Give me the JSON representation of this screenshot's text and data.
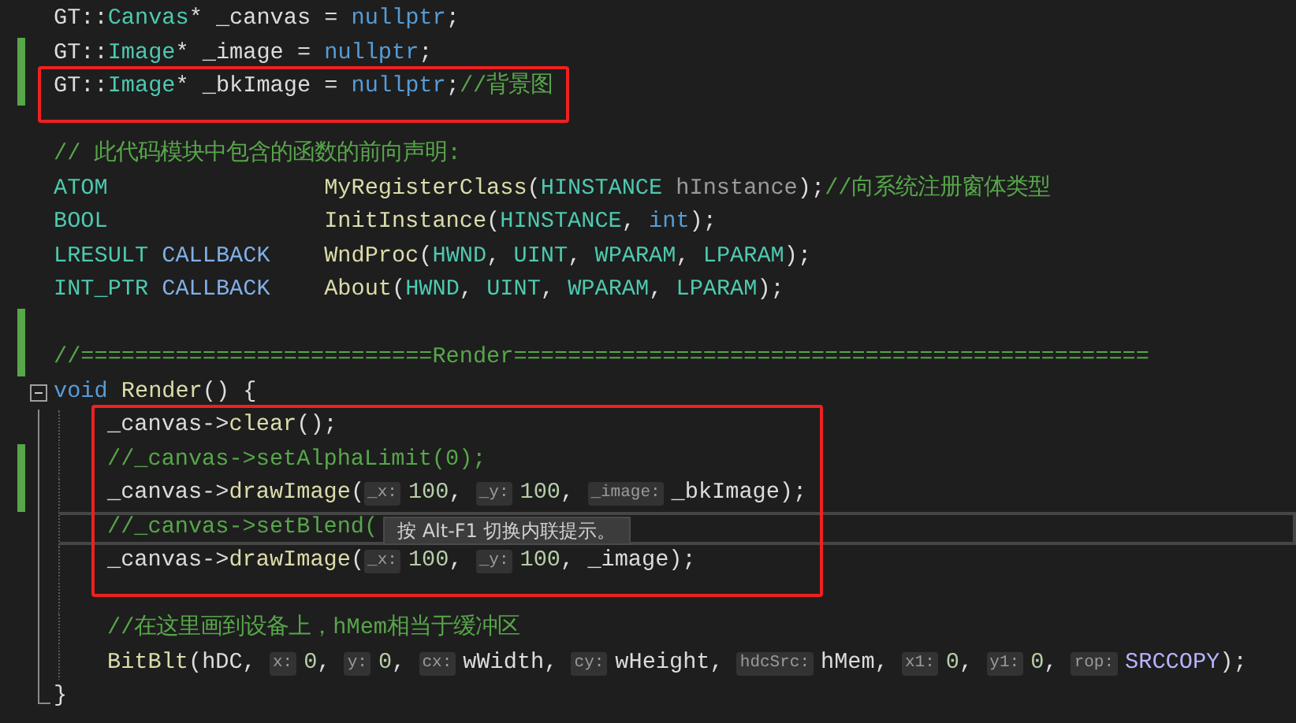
{
  "editor": {
    "lines": [
      {
        "changed": false,
        "tokens": [
          {
            "text": "GT::",
            "kind": "plain"
          },
          {
            "text": "Canvas",
            "kind": "type"
          },
          {
            "text": "* _canvas = ",
            "kind": "plain"
          },
          {
            "text": "nullptr",
            "kind": "keyword"
          },
          {
            "text": ";",
            "kind": "plain"
          }
        ]
      },
      {
        "changed": true,
        "tokens": [
          {
            "text": "GT::",
            "kind": "plain"
          },
          {
            "text": "Image",
            "kind": "type"
          },
          {
            "text": "* _image = ",
            "kind": "plain"
          },
          {
            "text": "nullptr",
            "kind": "keyword"
          },
          {
            "text": ";",
            "kind": "plain"
          }
        ]
      },
      {
        "changed": true,
        "boxed": true,
        "tokens": [
          {
            "text": "GT::",
            "kind": "plain"
          },
          {
            "text": "Image",
            "kind": "type"
          },
          {
            "text": "* _bkImage = ",
            "kind": "plain"
          },
          {
            "text": "nullptr",
            "kind": "keyword"
          },
          {
            "text": ";",
            "kind": "plain"
          },
          {
            "text": "//背景图",
            "kind": "comment"
          }
        ]
      },
      {
        "changed": false
      },
      {
        "changed": false,
        "tokens": [
          {
            "text": "// 此代码模块中包含的函数的前向声明:",
            "kind": "comment"
          }
        ]
      },
      {
        "changed": false,
        "tokens": [
          {
            "text": "ATOM",
            "kind": "type"
          }
        ],
        "aligned": [
          {
            "text": "MyRegisterClass",
            "kind": "func"
          },
          {
            "text": "(",
            "kind": "plain"
          },
          {
            "text": "HINSTANCE",
            "kind": "type"
          },
          {
            "text": " hInstance",
            "kind": "param"
          },
          {
            "text": ");",
            "kind": "plain"
          },
          {
            "text": "//向系统注册窗体类型",
            "kind": "comment"
          }
        ]
      },
      {
        "changed": false,
        "tokens": [
          {
            "text": "BOOL",
            "kind": "type"
          }
        ],
        "aligned": [
          {
            "text": "InitInstance",
            "kind": "func"
          },
          {
            "text": "(",
            "kind": "plain"
          },
          {
            "text": "HINSTANCE",
            "kind": "type"
          },
          {
            "text": ", ",
            "kind": "plain"
          },
          {
            "text": "int",
            "kind": "keyword"
          },
          {
            "text": ");",
            "kind": "plain"
          }
        ]
      },
      {
        "changed": false,
        "tokens": [
          {
            "text": "LRESULT",
            "kind": "type"
          },
          {
            "text": " CALLBACK",
            "kind": "macro"
          }
        ],
        "aligned": [
          {
            "text": "WndProc",
            "kind": "func"
          },
          {
            "text": "(",
            "kind": "plain"
          },
          {
            "text": "HWND",
            "kind": "type"
          },
          {
            "text": ", ",
            "kind": "plain"
          },
          {
            "text": "UINT",
            "kind": "type"
          },
          {
            "text": ", ",
            "kind": "plain"
          },
          {
            "text": "WPARAM",
            "kind": "type"
          },
          {
            "text": ", ",
            "kind": "plain"
          },
          {
            "text": "LPARAM",
            "kind": "type"
          },
          {
            "text": ");",
            "kind": "plain"
          }
        ]
      },
      {
        "changed": false,
        "tokens": [
          {
            "text": "INT_PTR",
            "kind": "type"
          },
          {
            "text": " CALLBACK",
            "kind": "macro"
          }
        ],
        "aligned": [
          {
            "text": "About",
            "kind": "func"
          },
          {
            "text": "(",
            "kind": "plain"
          },
          {
            "text": "HWND",
            "kind": "type"
          },
          {
            "text": ", ",
            "kind": "plain"
          },
          {
            "text": "UINT",
            "kind": "type"
          },
          {
            "text": ", ",
            "kind": "plain"
          },
          {
            "text": "WPARAM",
            "kind": "type"
          },
          {
            "text": ", ",
            "kind": "plain"
          },
          {
            "text": "LPARAM",
            "kind": "type"
          },
          {
            "text": ");",
            "kind": "plain"
          }
        ]
      },
      {
        "changed": true
      },
      {
        "changed": true,
        "tokens": [
          {
            "text": "//==========================Render===============================================",
            "kind": "comment"
          }
        ]
      },
      {
        "changed": false,
        "expanded": true,
        "tokens": [
          {
            "text": "void",
            "kind": "keyword"
          },
          {
            "text": " Render",
            "kind": "func"
          },
          {
            "text": "() {",
            "kind": "plain"
          }
        ],
        "children": [
          {
            "changed": false,
            "boxed": true,
            "tokens": [
              {
                "text": "_canvas->",
                "kind": "plain"
              },
              {
                "text": "clear",
                "kind": "func"
              },
              {
                "text": "();",
                "kind": "plain"
              }
            ]
          },
          {
            "changed": true,
            "boxed": true,
            "tokens": [
              {
                "text": "//_canvas->setAlphaLimit(0);",
                "kind": "comment"
              }
            ]
          },
          {
            "changed": true,
            "boxed": true,
            "tokens": [
              {
                "text": "_canvas->",
                "kind": "plain"
              },
              {
                "text": "drawImage",
                "kind": "func"
              },
              {
                "text": "(",
                "kind": "plain"
              },
              {
                "text": "_x:",
                "kind": "hint"
              },
              {
                "text": "100",
                "kind": "number"
              },
              {
                "text": ", ",
                "kind": "plain"
              },
              {
                "text": "_y:",
                "kind": "hint"
              },
              {
                "text": "100",
                "kind": "number"
              },
              {
                "text": ", ",
                "kind": "plain"
              },
              {
                "text": "_image:",
                "kind": "hint"
              },
              {
                "text": "_bkImage);",
                "kind": "plain"
              }
            ]
          },
          {
            "changed": false,
            "boxed": true,
            "current": true,
            "tooltip": "按 Alt-F1 切换内联提示。",
            "tokens": [
              {
                "text": "//_canvas->setBlend(",
                "kind": "comment"
              }
            ]
          },
          {
            "changed": false,
            "boxed": true,
            "tokens": [
              {
                "text": "_canvas->",
                "kind": "plain"
              },
              {
                "text": "drawImage",
                "kind": "func"
              },
              {
                "text": "(",
                "kind": "plain"
              },
              {
                "text": "_x:",
                "kind": "hint"
              },
              {
                "text": "100",
                "kind": "number"
              },
              {
                "text": ", ",
                "kind": "plain"
              },
              {
                "text": "_y:",
                "kind": "hint"
              },
              {
                "text": "100",
                "kind": "number"
              },
              {
                "text": ", ",
                "kind": "plain"
              },
              {
                "text": "_image);",
                "kind": "plain"
              }
            ]
          },
          {
            "changed": false
          },
          {
            "changed": false,
            "tokens": [
              {
                "text": "//在这里画到设备上，hMem相当于缓冲区",
                "kind": "comment"
              }
            ]
          },
          {
            "changed": false,
            "tokens": [
              {
                "text": "BitBlt",
                "kind": "func"
              },
              {
                "text": "(hDC, ",
                "kind": "plain"
              },
              {
                "text": "x:",
                "kind": "hint"
              },
              {
                "text": "0",
                "kind": "number"
              },
              {
                "text": ", ",
                "kind": "plain"
              },
              {
                "text": "y:",
                "kind": "hint"
              },
              {
                "text": "0",
                "kind": "number"
              },
              {
                "text": ", ",
                "kind": "plain"
              },
              {
                "text": "cx:",
                "kind": "hint"
              },
              {
                "text": "wWidth, ",
                "kind": "plain"
              },
              {
                "text": "cy:",
                "kind": "hint"
              },
              {
                "text": "wHeight, ",
                "kind": "plain"
              },
              {
                "text": "hdcSrc:",
                "kind": "hint"
              },
              {
                "text": "hMem, ",
                "kind": "plain"
              },
              {
                "text": "x1:",
                "kind": "hint"
              },
              {
                "text": "0",
                "kind": "number"
              },
              {
                "text": ", ",
                "kind": "plain"
              },
              {
                "text": "y1:",
                "kind": "hint"
              },
              {
                "text": "0",
                "kind": "number"
              },
              {
                "text": ", ",
                "kind": "plain"
              },
              {
                "text": "rop:",
                "kind": "hint"
              },
              {
                "text": "SRCCOPY",
                "kind": "macro2"
              },
              {
                "text": ");",
                "kind": "plain"
              }
            ]
          }
        ],
        "end": {
          "changed": false,
          "tokens": [
            {
              "text": "}",
              "kind": "plain"
            }
          ]
        }
      }
    ]
  }
}
